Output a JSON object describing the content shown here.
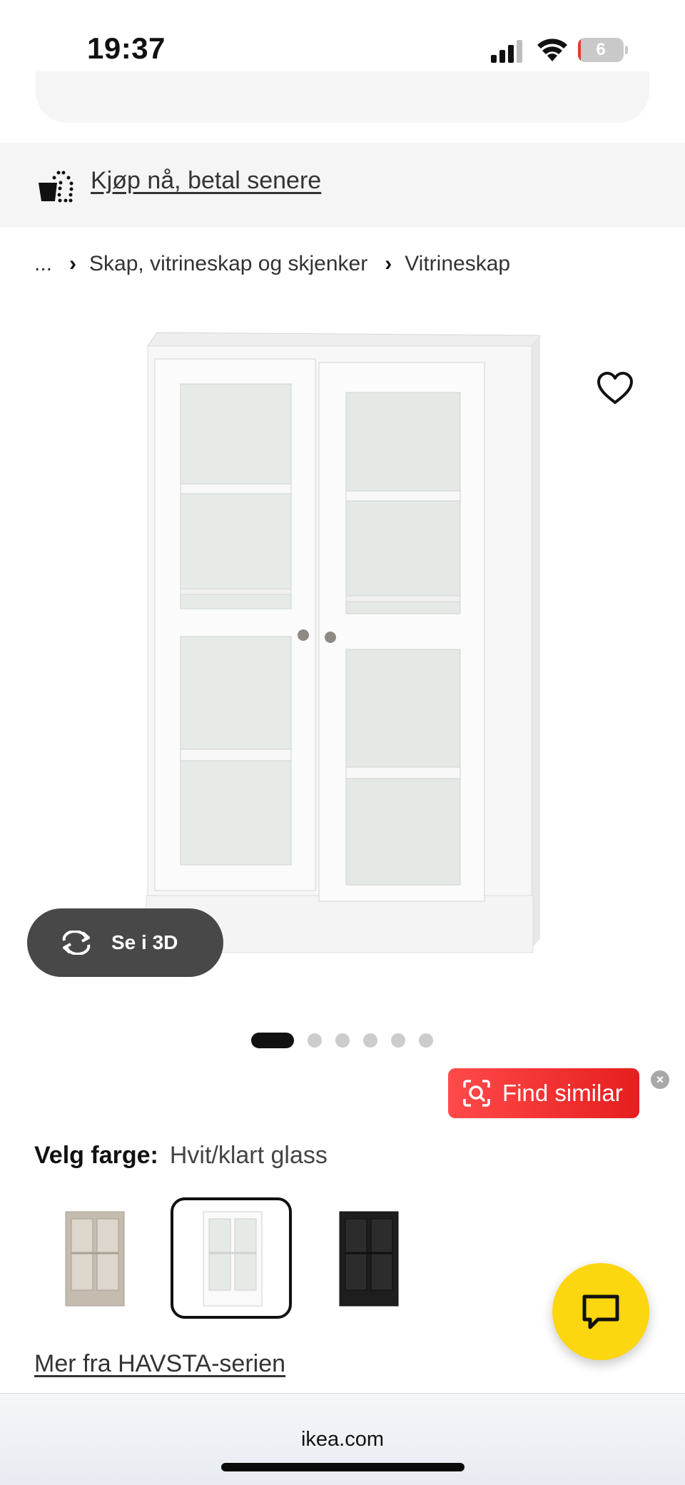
{
  "status_bar": {
    "time": "19:37",
    "battery_level": "6",
    "icons": [
      "signal-icon",
      "wifi-icon",
      "battery-icon"
    ]
  },
  "banner": {
    "link_text": "Kjøp nå, betal senere",
    "icon": "installment-basket-icon"
  },
  "breadcrumb": {
    "items": [
      "...",
      "Skap, vitrineskap og skjenker",
      "Vitrineskap"
    ]
  },
  "product": {
    "image_icon": "glass-door-cabinet-image",
    "favorite_icon": "heart-icon",
    "see_3d_label": "Se i 3D",
    "carousel": {
      "total": 6,
      "active": 1
    }
  },
  "find_similar": {
    "label": "Find similar",
    "close": "×"
  },
  "color": {
    "label": "Velg farge:",
    "value": "Hvit/klart glass",
    "swatches": [
      {
        "name": "beige",
        "color": "#c9c1b6",
        "selected": false
      },
      {
        "name": "white",
        "color": "#f4f4f4",
        "selected": true
      },
      {
        "name": "black",
        "color": "#1e1e1e",
        "selected": false
      }
    ]
  },
  "series_link": "Mer fra HAVSTA-serien",
  "chat": {
    "icon": "chat-bubble-icon",
    "color": "#fcd60e"
  },
  "browser": {
    "url": "ikea.com"
  },
  "colors": {
    "accent_red": "#e61e1e",
    "brand_yellow": "#fcd60e"
  }
}
